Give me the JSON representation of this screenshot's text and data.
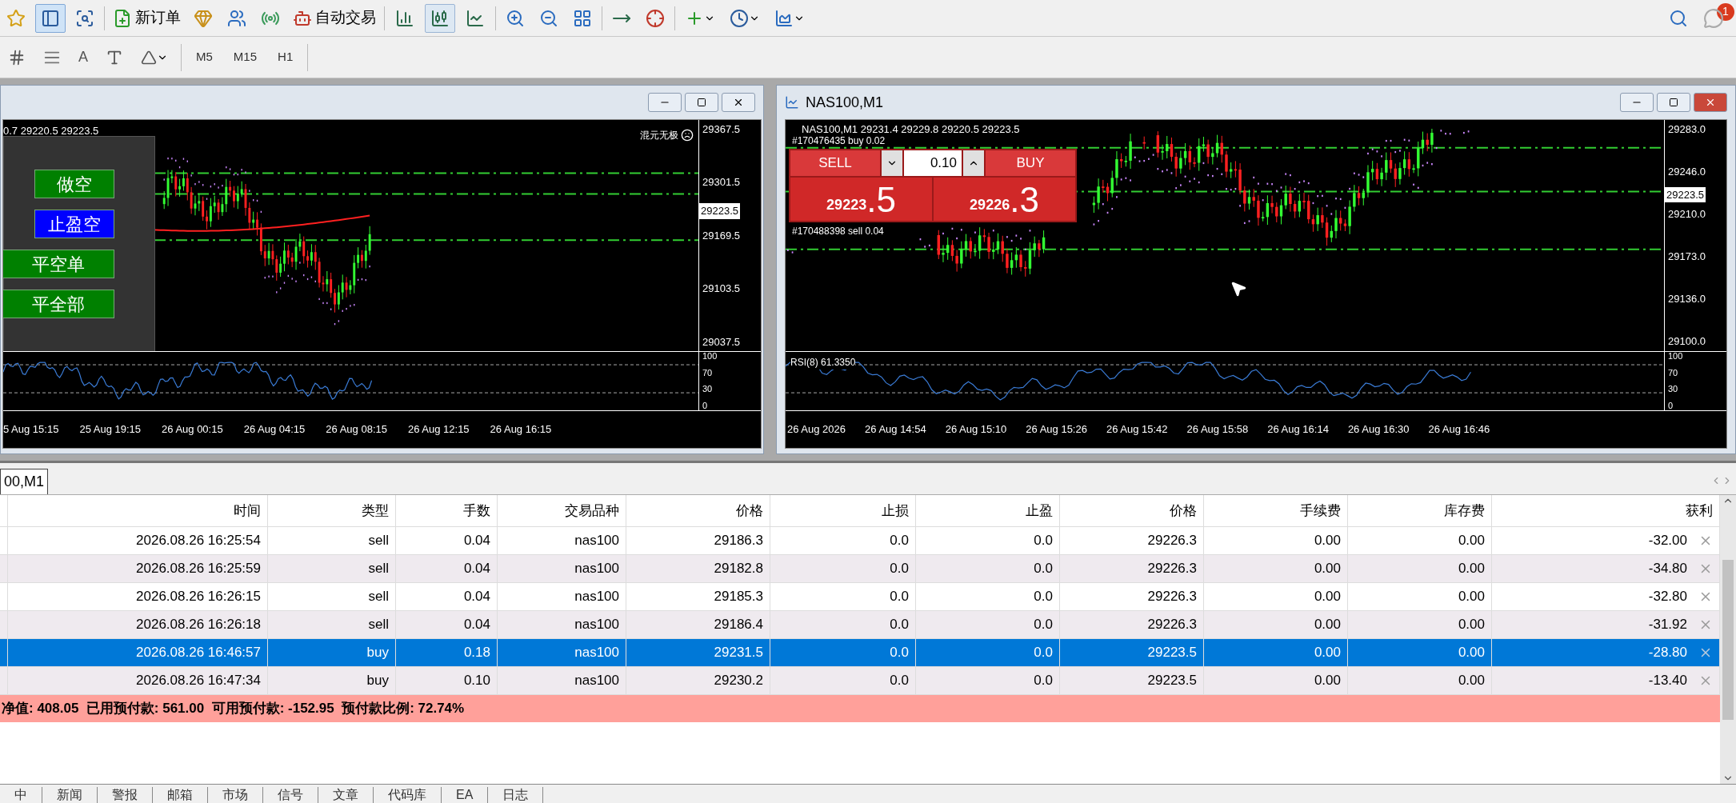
{
  "toolbar": {
    "new_order": "新订单",
    "auto_trading": "自动交易",
    "chart_types": [
      {
        "selected": false
      },
      {
        "selected": true
      },
      {
        "selected": false
      }
    ],
    "text_tool": "A",
    "timeframes": [
      "M5",
      "M15",
      "H1"
    ],
    "notification_count": "1"
  },
  "left_chart": {
    "info": "0.7 29220.5 29223.5",
    "indicator_label": "混元无极",
    "panel_buttons": [
      {
        "label": "做空",
        "color": "#008000"
      },
      {
        "label": "止盈空",
        "color": "#0000ff"
      },
      {
        "label": "平空单",
        "color": "#008000"
      },
      {
        "label": "平全部",
        "color": "#008000"
      }
    ],
    "price_ticks": [
      "29367.5",
      "29301.5",
      "29169.5",
      "29103.5",
      "29037.5"
    ],
    "current_price": "29223.5",
    "rsi_ticks": [
      "100",
      "70",
      "30",
      "0"
    ],
    "time_labels": [
      "5 Aug 15:15",
      "25 Aug 19:15",
      "26 Aug 00:15",
      "26 Aug 04:15",
      "26 Aug 08:15",
      "26 Aug 12:15",
      "26 Aug 16:15"
    ]
  },
  "right_chart": {
    "title": "NAS100,M1",
    "info": "NAS100,M1 29231.4 29229.8 29220.5 29223.5",
    "order_labels": [
      "#170476435 buy 0.02",
      "#170488398 sell 0.04"
    ],
    "one_click": {
      "sell": "SELL",
      "buy": "BUY",
      "volume": "0.10",
      "bid_main": "29223",
      "bid_big": ".5",
      "ask_main": "29226",
      "ask_big": ".3"
    },
    "price_ticks": [
      "29283.0",
      "29246.0",
      "29210.0",
      "29173.0",
      "29136.0",
      "29100.0"
    ],
    "current_price": "29223.5",
    "rsi_label": "RSI(8) 61.3350",
    "rsi_ticks": [
      "100",
      "70",
      "30",
      "0"
    ],
    "time_labels": [
      "26 Aug 2026",
      "26 Aug 14:54",
      "26 Aug 15:10",
      "26 Aug 15:26",
      "26 Aug 15:42",
      "26 Aug 15:58",
      "26 Aug 16:14",
      "26 Aug 16:30",
      "26 Aug 16:46"
    ]
  },
  "terminal": {
    "tab": "00,M1",
    "columns": [
      "时间",
      "类型",
      "手数",
      "交易品种",
      "价格",
      "止损",
      "止盈",
      "价格",
      "手续费",
      "库存费",
      "获利"
    ],
    "rows": [
      {
        "cells": [
          "2026.08.26 16:25:54",
          "sell",
          "0.04",
          "nas100",
          "29186.3",
          "0.0",
          "0.0",
          "29226.3",
          "0.00",
          "0.00",
          "-32.00"
        ],
        "selected": false
      },
      {
        "cells": [
          "2026.08.26 16:25:59",
          "sell",
          "0.04",
          "nas100",
          "29182.8",
          "0.0",
          "0.0",
          "29226.3",
          "0.00",
          "0.00",
          "-34.80"
        ],
        "selected": false
      },
      {
        "cells": [
          "2026.08.26 16:26:15",
          "sell",
          "0.04",
          "nas100",
          "29185.3",
          "0.0",
          "0.0",
          "29226.3",
          "0.00",
          "0.00",
          "-32.80"
        ],
        "selected": false
      },
      {
        "cells": [
          "2026.08.26 16:26:18",
          "sell",
          "0.04",
          "nas100",
          "29186.4",
          "0.0",
          "0.0",
          "29226.3",
          "0.00",
          "0.00",
          "-31.92"
        ],
        "selected": false
      },
      {
        "cells": [
          "2026.08.26 16:46:57",
          "buy",
          "0.18",
          "nas100",
          "29231.5",
          "0.0",
          "0.0",
          "29223.5",
          "0.00",
          "0.00",
          "-28.80"
        ],
        "selected": true
      },
      {
        "cells": [
          "2026.08.26 16:47:34",
          "buy",
          "0.10",
          "nas100",
          "29230.2",
          "0.0",
          "0.0",
          "29223.5",
          "0.00",
          "0.00",
          "-13.40"
        ],
        "selected": false
      }
    ],
    "summary": "净值: 408.05  已用预付款: 561.00  可用预付款: -152.95  预付款比例: 72.74%",
    "bottom_tabs": [
      "中",
      "新闻",
      "警报",
      "邮箱",
      "市场",
      "信号",
      "文章",
      "代码库",
      "EA",
      "日志"
    ]
  }
}
